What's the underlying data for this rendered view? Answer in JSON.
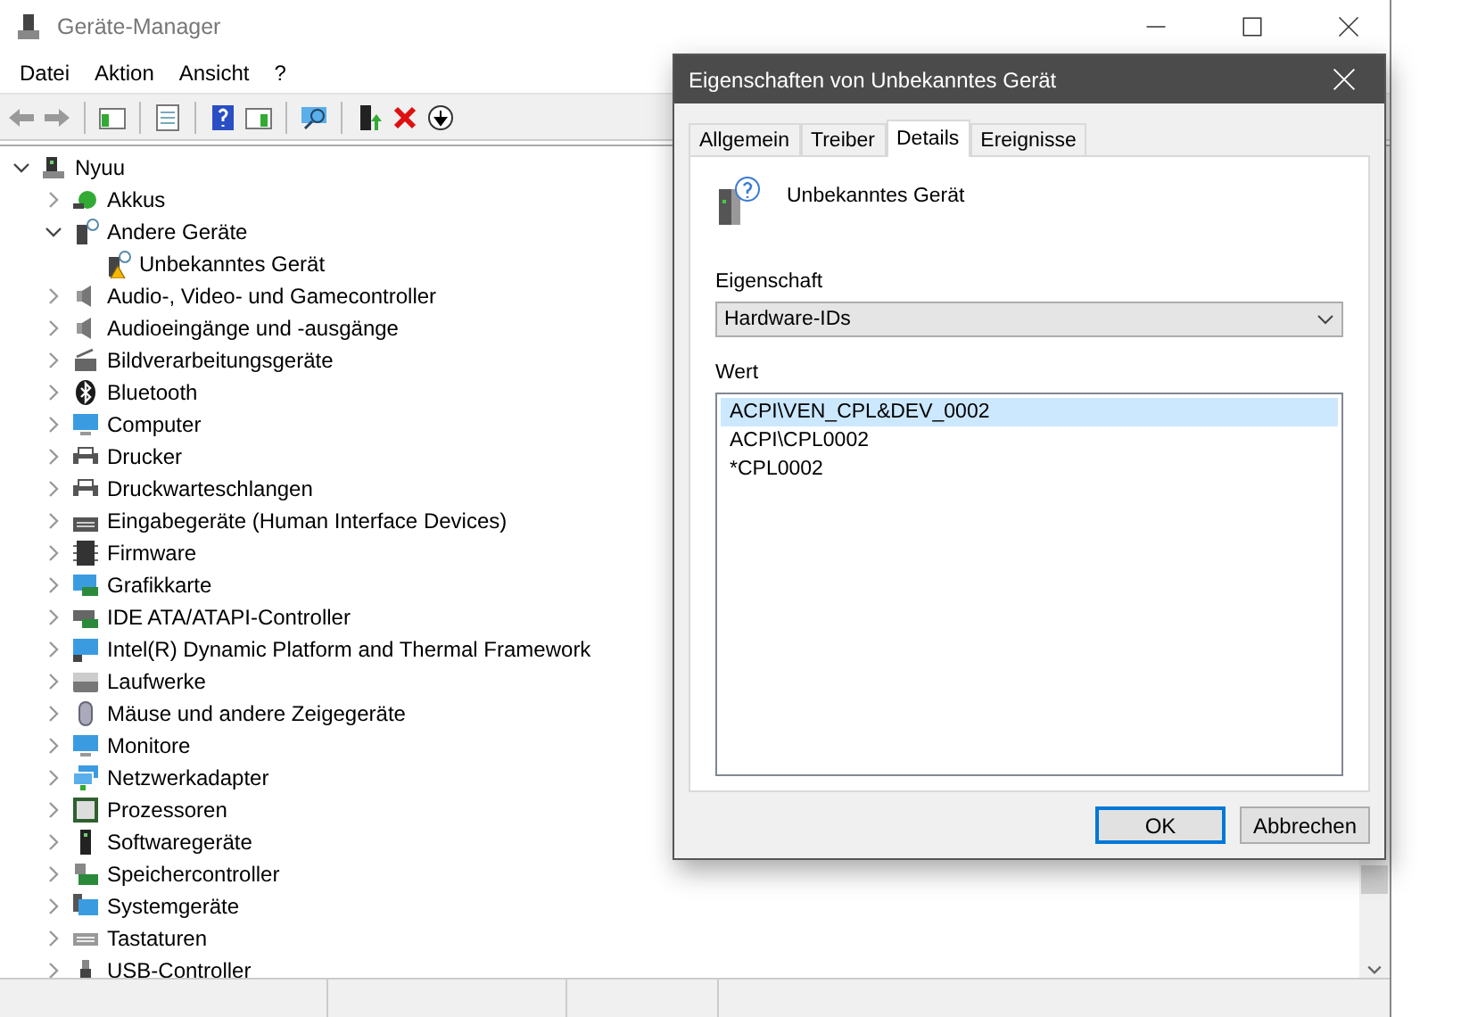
{
  "window": {
    "title": "Geräte-Manager"
  },
  "menu": [
    "Datei",
    "Aktion",
    "Ansicht",
    "?"
  ],
  "tree": {
    "label": "Nyuu",
    "expanded": true,
    "children": [
      {
        "label": "Akkus",
        "expanded": false
      },
      {
        "label": "Andere Geräte",
        "expanded": true,
        "children": [
          {
            "label": "Unbekanntes Gerät",
            "warning": true
          }
        ]
      },
      {
        "label": "Audio-, Video- und Gamecontroller",
        "expanded": false
      },
      {
        "label": "Audioeingänge und -ausgänge",
        "expanded": false
      },
      {
        "label": "Bildverarbeitungsgeräte",
        "expanded": false
      },
      {
        "label": "Bluetooth",
        "expanded": false
      },
      {
        "label": "Computer",
        "expanded": false
      },
      {
        "label": "Drucker",
        "expanded": false
      },
      {
        "label": "Druckwarteschlangen",
        "expanded": false
      },
      {
        "label": "Eingabegeräte (Human Interface Devices)",
        "expanded": false
      },
      {
        "label": "Firmware",
        "expanded": false
      },
      {
        "label": "Grafikkarte",
        "expanded": false
      },
      {
        "label": "IDE ATA/ATAPI-Controller",
        "expanded": false
      },
      {
        "label": "Intel(R) Dynamic Platform and Thermal Framework",
        "expanded": false
      },
      {
        "label": "Laufwerke",
        "expanded": false
      },
      {
        "label": "Mäuse und andere Zeigegeräte",
        "expanded": false
      },
      {
        "label": "Monitore",
        "expanded": false
      },
      {
        "label": "Netzwerkadapter",
        "expanded": false
      },
      {
        "label": "Prozessoren",
        "expanded": false
      },
      {
        "label": "Softwaregeräte",
        "expanded": false
      },
      {
        "label": "Speichercontroller",
        "expanded": false
      },
      {
        "label": "Systemgeräte",
        "expanded": false
      },
      {
        "label": "Tastaturen",
        "expanded": false
      },
      {
        "label": "USB-Controller",
        "expanded": false
      }
    ]
  },
  "dialog": {
    "title": "Eigenschaften von Unbekanntes Gerät",
    "tabs": [
      {
        "label": "Allgemein",
        "selected": false
      },
      {
        "label": "Treiber",
        "selected": false
      },
      {
        "label": "Details",
        "selected": true
      },
      {
        "label": "Ereignisse",
        "selected": false
      }
    ],
    "device_name": "Unbekanntes Gerät",
    "property_label": "Eigenschaft",
    "property_select": {
      "value": "Hardware-IDs"
    },
    "value_label": "Wert",
    "values": [
      {
        "text": "ACPI\\VEN_CPL&DEV_0002",
        "selected": true
      },
      {
        "text": "ACPI\\CPL0002",
        "selected": false
      },
      {
        "text": "*CPL0002",
        "selected": false
      }
    ],
    "buttons": [
      {
        "label": "OK",
        "default": true
      },
      {
        "label": "Abbrechen",
        "default": false
      }
    ]
  }
}
